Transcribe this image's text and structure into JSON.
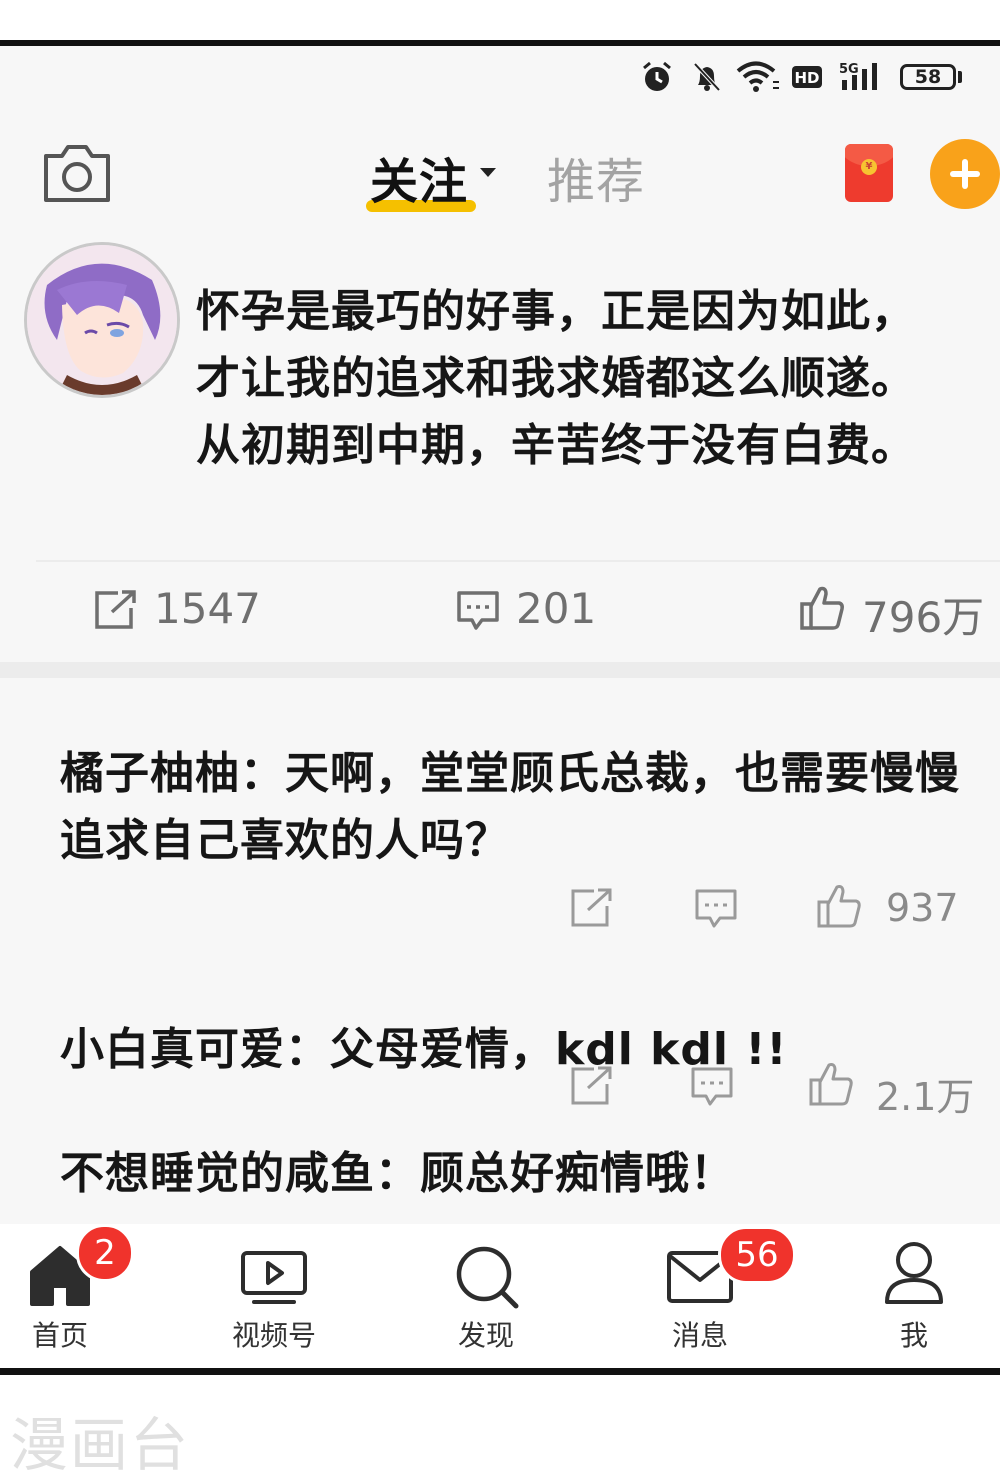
{
  "status_bar": {
    "battery": "58",
    "network": "5G"
  },
  "header": {
    "tabs": [
      {
        "label": "关注",
        "active": true
      },
      {
        "label": "推荐",
        "active": false
      }
    ],
    "accent_color": "#f5c000",
    "add_button_color": "#f9a21a"
  },
  "post": {
    "text": "怀孕是最巧的好事，正是因为如此，\n才让我的追求和我求婚都这么顺遂。\n从初期到中期，辛苦终于没有白费。",
    "repost_count": "1547",
    "comment_count": "201",
    "like_count": "796万"
  },
  "comments": [
    {
      "text": "橘子柚柚：天啊，堂堂顾氏总裁，也需要慢慢追求自己喜欢的人吗？",
      "like_count": "937"
    },
    {
      "text": "小白真可爱：父母爱情，kdl kdl !!",
      "like_count": "2.1万"
    },
    {
      "text": "不想睡觉的咸鱼：顾总好痴情哦！"
    }
  ],
  "bottom_nav": {
    "items": [
      {
        "label": "首页",
        "icon": "home-icon",
        "badge": "2"
      },
      {
        "label": "视频号",
        "icon": "video-icon"
      },
      {
        "label": "发现",
        "icon": "search-icon"
      },
      {
        "label": "消息",
        "icon": "mail-icon",
        "badge": "56"
      },
      {
        "label": "我",
        "icon": "profile-icon"
      }
    ],
    "badge_color": "#f0332c"
  },
  "watermark": "漫画台"
}
